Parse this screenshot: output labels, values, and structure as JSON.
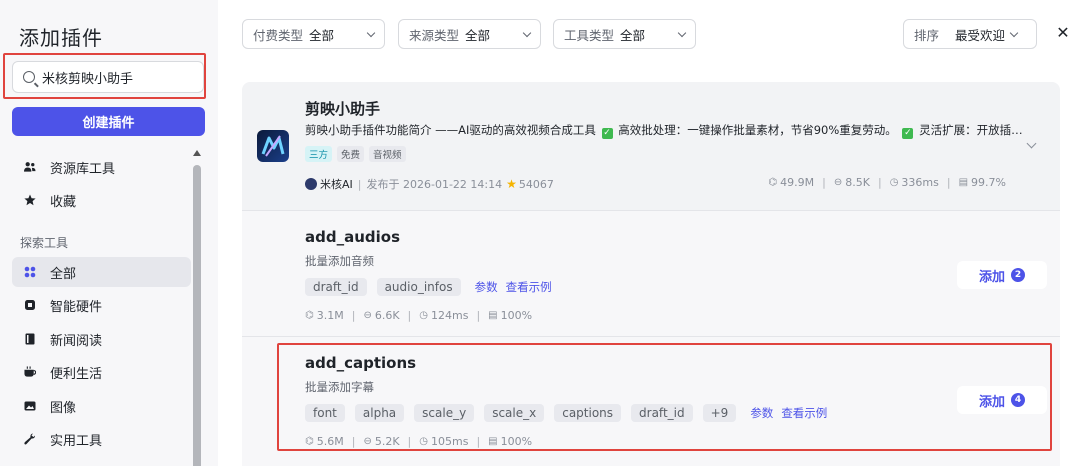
{
  "sidebar": {
    "title": "添加插件",
    "search_value": "米核剪映小助手",
    "create_label": "创建插件",
    "top_items": [
      {
        "label": "资源库工具",
        "icon": "users-icon"
      },
      {
        "label": "收藏",
        "icon": "star-icon"
      }
    ],
    "section_label": "探索工具",
    "explore_items": [
      {
        "label": "全部",
        "icon": "grid-icon",
        "active": true
      },
      {
        "label": "智能硬件",
        "icon": "chip-icon"
      },
      {
        "label": "新闻阅读",
        "icon": "book-icon"
      },
      {
        "label": "便利生活",
        "icon": "cup-icon"
      },
      {
        "label": "图像",
        "icon": "image-icon"
      },
      {
        "label": "实用工具",
        "icon": "wrench-icon"
      }
    ]
  },
  "filters": {
    "pay": {
      "label": "付费类型",
      "value": "全部"
    },
    "source": {
      "label": "来源类型",
      "value": "全部"
    },
    "tool": {
      "label": "工具类型",
      "value": "全部"
    },
    "sort": {
      "label": "排序",
      "value": "最受欢迎"
    }
  },
  "featured": {
    "title": "剪映小助手",
    "desc_1": "剪映小助手插件功能简介 ——AI驱动的高效视频合成工具",
    "desc_2": "高效批处理：一键操作批量素材，节省90%重复劳动。",
    "desc_3": "灵活扩展：开放插…",
    "badges": [
      "三方",
      "免费",
      "音视频"
    ],
    "author": "米核AI",
    "published": "发布于 2026-01-22 14:14",
    "stars": "54067",
    "stats": [
      "49.9M",
      "8.5K",
      "336ms",
      "99.7%"
    ]
  },
  "tools": [
    {
      "name": "add_audios",
      "desc": "批量添加音频",
      "params": [
        "draft_id",
        "audio_infos"
      ],
      "params_link": "参数",
      "example_link": "查看示例",
      "stats": [
        "3.1M",
        "6.6K",
        "124ms",
        "100%"
      ],
      "add_label": "添加",
      "add_count": "2"
    },
    {
      "name": "add_captions",
      "desc": "批量添加字幕",
      "params": [
        "font",
        "alpha",
        "scale_y",
        "scale_x",
        "captions",
        "draft_id",
        "+9"
      ],
      "params_link": "参数",
      "example_link": "查看示例",
      "stats": [
        "5.6M",
        "5.2K",
        "105ms",
        "100%"
      ],
      "add_label": "添加",
      "add_count": "4"
    }
  ],
  "colors": {
    "accent": "#4d53e8",
    "highlight": "#e0443e",
    "check": "#3fb950"
  }
}
